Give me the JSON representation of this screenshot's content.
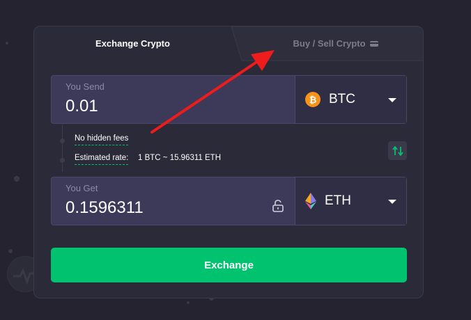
{
  "tabs": {
    "exchange_label": "Exchange Crypto",
    "buy_sell_label": "Buy / Sell Crypto"
  },
  "send": {
    "label": "You Send",
    "value": "0.01",
    "currency": "BTC",
    "currency_icon": "bitcoin-icon"
  },
  "info": {
    "fees": "No hidden fees",
    "rate_label": "Estimated rate:",
    "rate_value": "1 BTC ~ 15.96311 ETH"
  },
  "get": {
    "label": "You Get",
    "value": "0.1596311",
    "currency": "ETH",
    "currency_icon": "ethereum-icon"
  },
  "exchange_button": "Exchange",
  "colors": {
    "accent": "#00c26f",
    "bitcoin": "#f7931a",
    "annotation_arrow": "#ee1c1c"
  }
}
